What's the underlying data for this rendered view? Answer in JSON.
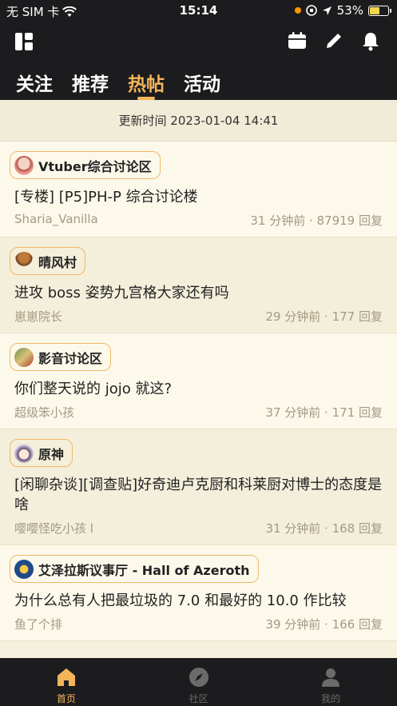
{
  "status_bar": {
    "carrier": "无 SIM 卡",
    "time": "15:14",
    "battery": "53%"
  },
  "tabs": [
    {
      "label": "关注",
      "active": false
    },
    {
      "label": "推荐",
      "active": false
    },
    {
      "label": "热帖",
      "active": true
    },
    {
      "label": "活动",
      "active": false
    }
  ],
  "updated_text": "更新时间 2023-01-04 14:41",
  "posts": [
    {
      "forum": "Vtuber综合讨论区",
      "title": "[专楼] [P5]PH-P 综合讨论楼",
      "author": "Sharia_Vanilla",
      "meta": "31 分钟前 · 87919 回复"
    },
    {
      "forum": "晴风村",
      "title": "进攻 boss 姿势九宫格大家还有吗",
      "author": "崽崽院长",
      "meta": "29 分钟前 · 177 回复"
    },
    {
      "forum": "影音讨论区",
      "title": "你们整天说的 jojo 就这?",
      "author": "超级笨小孩",
      "meta": "37 分钟前 · 171 回复"
    },
    {
      "forum": "原神",
      "title": "[闲聊杂谈][调查贴]好奇迪卢克厨和科莱厨对博士的态度是啥",
      "author": "嘤嘤怪吃小孩 l",
      "meta": "31 分钟前 · 168 回复"
    },
    {
      "forum": "艾泽拉斯议事厅 - Hall of Azeroth",
      "title": "为什么总有人把最垃圾的 7.0 和最好的 10.0 作比较",
      "author": "鱼了个排",
      "meta": "39 分钟前 · 166 回复"
    }
  ],
  "bottom_nav": [
    {
      "label": "首页",
      "icon": "home-icon",
      "active": true
    },
    {
      "label": "社区",
      "icon": "compass-icon",
      "active": false
    },
    {
      "label": "我的",
      "icon": "user-icon",
      "active": false
    }
  ],
  "colors": {
    "accent": "#f3b55a",
    "dark_bg": "#1c1c1e",
    "content_bg": "#f6f1de"
  }
}
